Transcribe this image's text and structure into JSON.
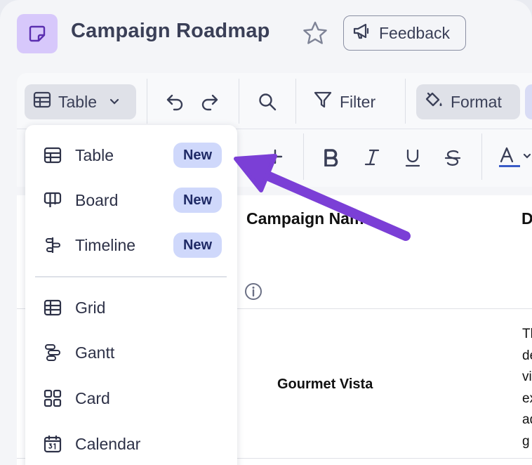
{
  "header": {
    "title": "Campaign Roadmap",
    "feedback_label": "Feedback"
  },
  "toolbar": {
    "view_label": "Table",
    "filter_label": "Filter",
    "format_label": "Format"
  },
  "table": {
    "column_header": "Campaign Name",
    "column_header_next": "D",
    "row": {
      "name": "Gourmet Vista",
      "description_fragments": [
        "Th",
        "de",
        "vi",
        "ex",
        "ad",
        "g"
      ]
    }
  },
  "view_menu": {
    "primary_items": [
      {
        "label": "Table",
        "badge": "New",
        "icon": "table-icon"
      },
      {
        "label": "Board",
        "badge": "New",
        "icon": "board-icon"
      },
      {
        "label": "Timeline",
        "badge": "New",
        "icon": "timeline-icon"
      }
    ],
    "secondary_items": [
      {
        "label": "Grid",
        "icon": "grid-icon"
      },
      {
        "label": "Gantt",
        "icon": "gantt-icon"
      },
      {
        "label": "Card",
        "icon": "card-icon"
      },
      {
        "label": "Calendar",
        "icon": "calendar-icon"
      }
    ]
  },
  "colors": {
    "accent": "#7b3fd6",
    "app_icon_bg": "#d7c8fb",
    "badge_bg": "#cfd8fb",
    "badge_text": "#1f2a66",
    "text_underline": "#3a5bc7"
  }
}
